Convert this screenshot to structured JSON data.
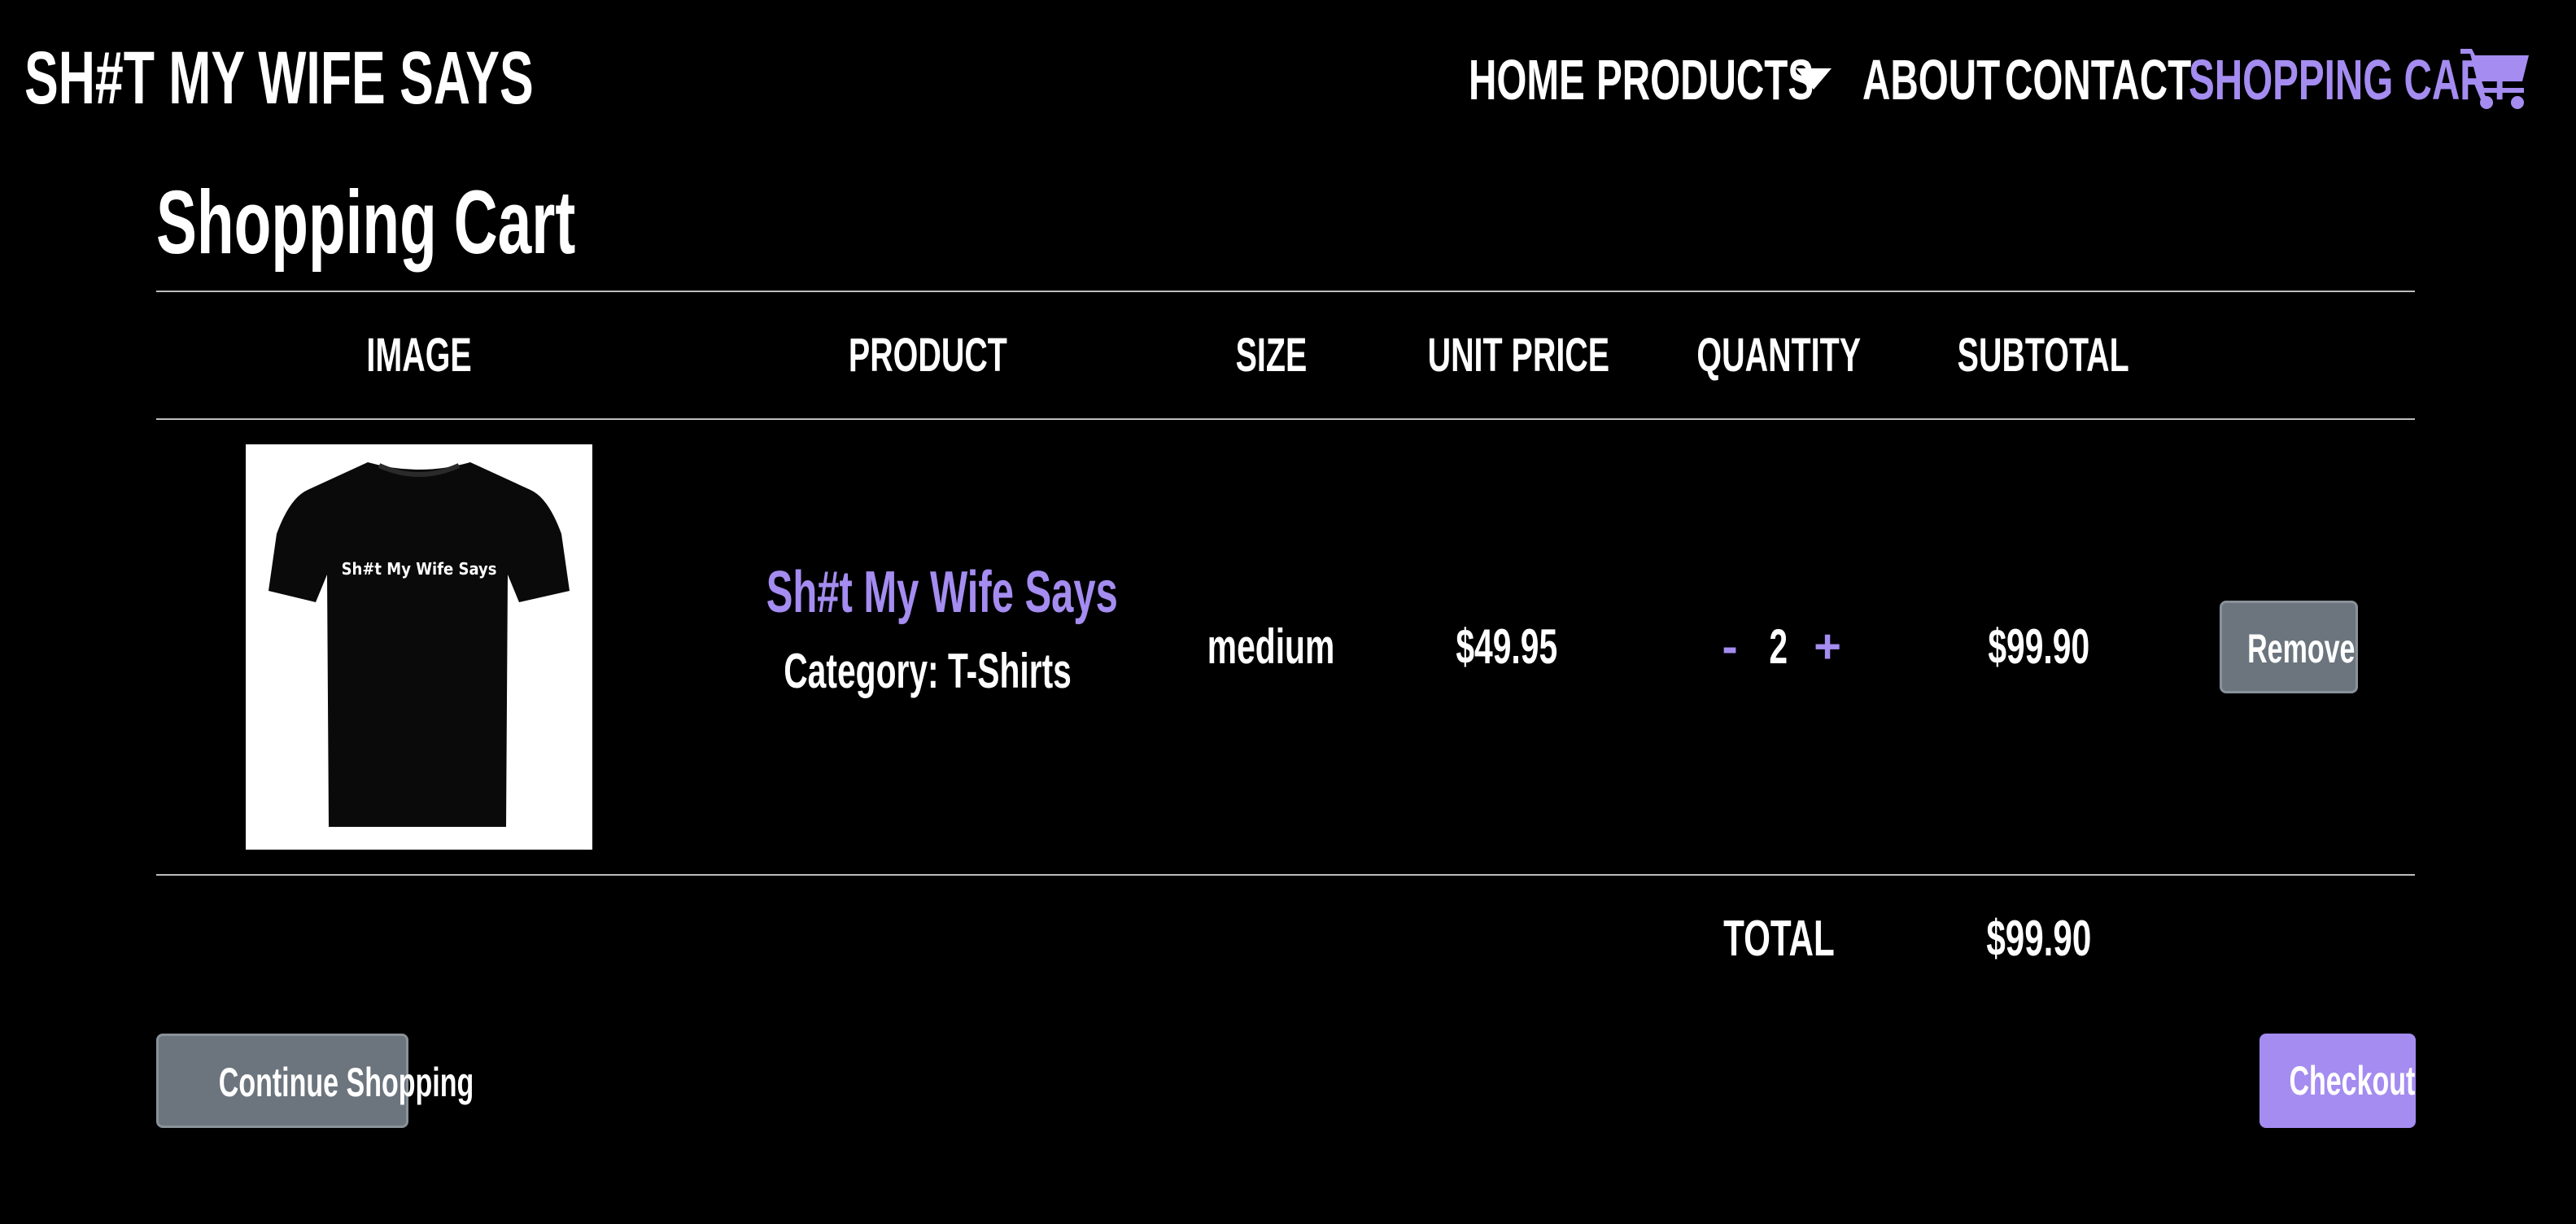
{
  "brand": {
    "name": "SH#T MY WIFE SAYS"
  },
  "nav": {
    "home": "HOME",
    "products": "PRODUCTS",
    "about": "ABOUT",
    "contact": "CONTACT",
    "cart": "SHOPPING CART"
  },
  "page": {
    "title": "Shopping Cart"
  },
  "table": {
    "headers": [
      "IMAGE",
      "PRODUCT",
      "SIZE",
      "UNIT PRICE",
      "QUANTITY",
      "SUBTOTAL"
    ],
    "rows": [
      {
        "image_text": "Sh#t My Wife Says",
        "product_name": "Sh#t My Wife Says",
        "category": "Category: T-Shirts",
        "size": "medium",
        "unit_price": "$49.95",
        "quantity": "2",
        "decrement": "-",
        "increment": "+",
        "subtotal": "$99.90",
        "remove_label": "Remove"
      }
    ],
    "total_label": "TOTAL",
    "total_value": "$99.90"
  },
  "actions": {
    "continue_label": "Continue Shopping",
    "checkout_label": "Checkout"
  },
  "colors": {
    "accent": "#a48cf0",
    "secondary_button": "#6c757d",
    "background": "#000000"
  },
  "icons": {
    "cart": "shopping-cart-icon",
    "caret": "chevron-down-icon"
  }
}
